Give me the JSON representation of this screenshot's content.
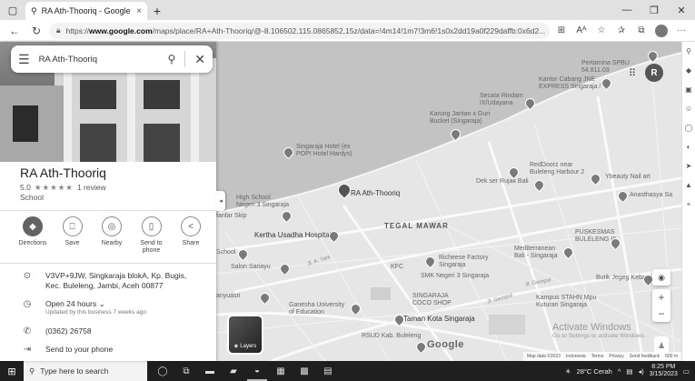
{
  "browser": {
    "tab_title": "RA Ath-Thooriq - Google Maps",
    "tab_close": "×",
    "new_tab": "+",
    "url_prefix": "https://",
    "url_domain": "www.google.com",
    "url_rest": "/maps/place/RA+Ath-Thooriq/@-8.106502,115.0865852,15z/data=!4m14!1m7!3m6!1s0x2dd19a0f229daffb:0x6d2...",
    "read_aloud": "Aᴬ"
  },
  "search": {
    "query": "RA Ath-Thooriq"
  },
  "place": {
    "name": "RA Ath-Thooriq",
    "rating": "5.0",
    "stars": "★★★★★",
    "reviews": "1 review",
    "category": "School"
  },
  "actions": [
    {
      "label": "Directions"
    },
    {
      "label": "Save"
    },
    {
      "label": "Nearby"
    },
    {
      "label": "Send to phone"
    },
    {
      "label": "Share"
    }
  ],
  "info": {
    "address": "V3VP+9JW, Singkaraja blokA, Kp. Bugis, Kec. Buleleng, Jambi, Aceh 00877",
    "hours": "Open 24 hours",
    "hours_note": "Updated by this business 7 weeks ago",
    "phone": "(0362) 26758",
    "send": "Send to your phone"
  },
  "map": {
    "user_initial": "R",
    "layers_label": "Layers",
    "google": "Google",
    "attrib": [
      "Map data ©2023",
      "Indonesia",
      "Terms",
      "Privacy",
      "Send feedback",
      "500 m"
    ],
    "watermark_title": "Activate Windows",
    "watermark_sub": "Go to Settings to activate Windows.",
    "labels": {
      "pertamina": "Pertamina SPBU\n54.811.03",
      "kantor": "Kantor Cabang JNE\nEXPRESS Singaraja /",
      "secata": "Secata Rindam\nIX/Udayana",
      "karung": "Karung Jantan x Guri\nBucket (Singaraja)",
      "hotel": "Singaraja Hotel (ex\nPOP! Hotel Hardys)",
      "redboorz": "RedDoorz near\nBuleleng Harbour 2",
      "ybeauty": "Ybeauty Nail art",
      "dek": "Dek ser Rujak Bali",
      "anasthasya": "Anasthasya Sa",
      "ath": "RA Ath-Thooriq",
      "tegal": "TEGAL MAWAR",
      "kertha": "Kertha Usadha Hospital",
      "puskesmas": "PUSKESMAS\nBULELENG III",
      "mediterranean": "Mediterranean\nBali - Singaraja",
      "richeese": "Richeese Factory\nSingaraja",
      "kfc": "KFC",
      "smk": "SMK Negeri 3 Singaraja",
      "butik": "Butik Jegeg Kebaya",
      "salon": "Salon Sariayu",
      "school": "School",
      "ganesha": "Ganesha University\nof Education",
      "coco": "SINGARAJA\nCOCO SHOP",
      "taman": "Taman Kota Singaraja",
      "kampus": "Kampus STAHN Mpu\nKuturan Singaraja",
      "rsud": "RSUD Kab. Buleleng",
      "high": "High School\nNegeri 3 Singaraja",
      "fanfar": "fanfar Skip",
      "anyuasri": "anyuasri",
      "jl_yani": "JL A. Yani",
      "jl_gempol": "Jl. Gempol",
      "jl_gempol2": "Jl. Gempol"
    }
  },
  "taskbar": {
    "search_placeholder": "Type here to search",
    "weather": "28°C  Cerah",
    "time": "8:25 PM",
    "date": "3/15/2023"
  }
}
